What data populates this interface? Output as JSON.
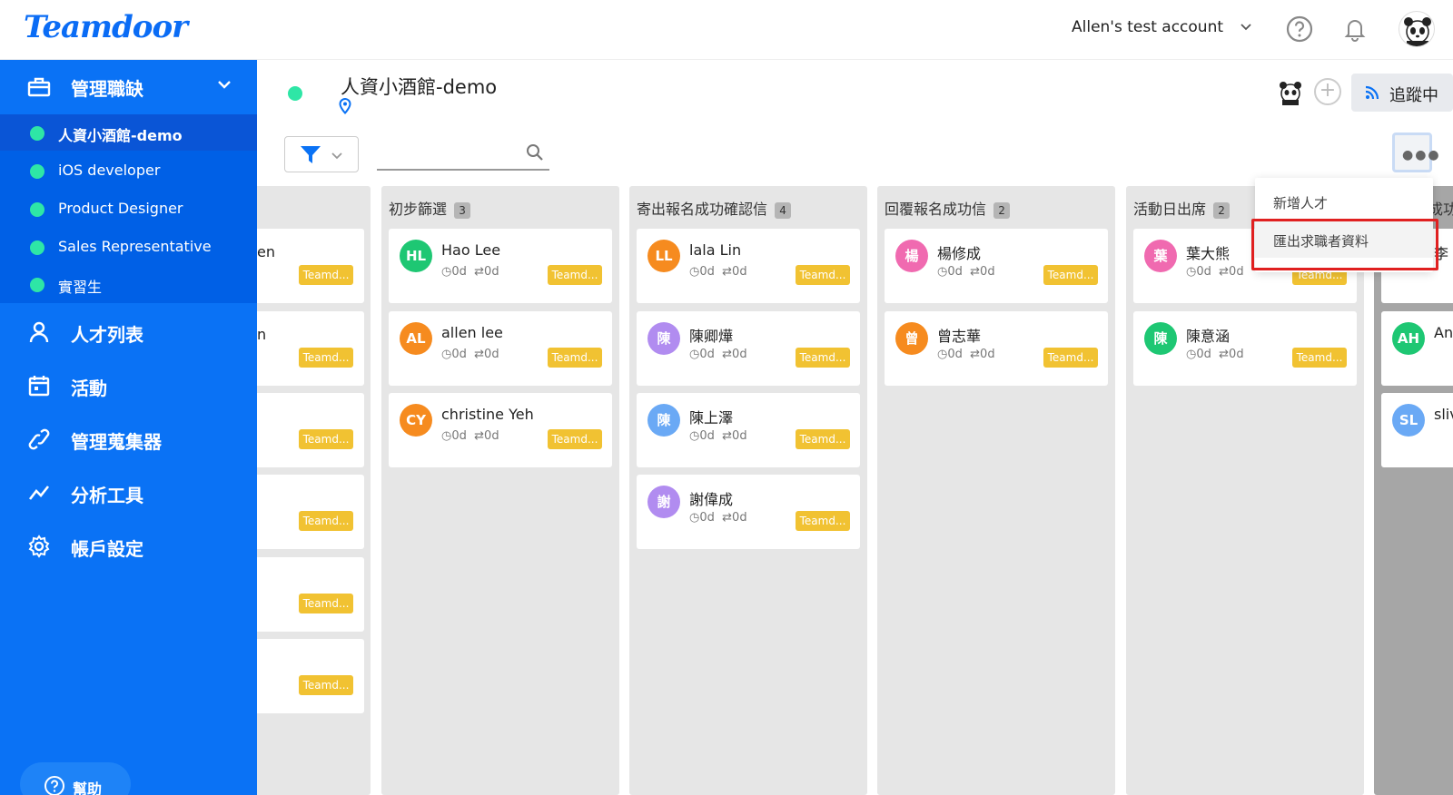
{
  "app": {
    "brand": "Teamdoor"
  },
  "topbar": {
    "account": "Allen's test account",
    "account_chevron": "chevron-down-icon",
    "help_icon": "help-circle-icon",
    "bell_icon": "bell-icon",
    "avatar_icon": "panda-avatar"
  },
  "sidebar": {
    "group": {
      "label": "管理職缺",
      "icon": "briefcase-icon"
    },
    "jobs": [
      {
        "label": "人資小酒館-demo",
        "active": true
      },
      {
        "label": "iOS developer",
        "active": false
      },
      {
        "label": "Product Designer",
        "active": false
      },
      {
        "label": "Sales Representative",
        "active": false
      },
      {
        "label": "實習生",
        "active": false
      }
    ],
    "nav": [
      {
        "label": "人才列表",
        "icon": "person-icon"
      },
      {
        "label": "活動",
        "icon": "calendar-icon"
      },
      {
        "label": "管理蒐集器",
        "icon": "link-icon"
      },
      {
        "label": "分析工具",
        "icon": "chart-line-icon"
      },
      {
        "label": "帳戶設定",
        "icon": "gear-icon"
      }
    ],
    "help_label": "幫助"
  },
  "header": {
    "job_title": "人資小酒館-demo",
    "follow_label": "追蹤中"
  },
  "toolbar": {
    "search_placeholder": ""
  },
  "columns": [
    {
      "title": "初步篩選",
      "count": "3",
      "cards": [
        {
          "initials": "HL",
          "name": "Hao Lee",
          "time": "0d",
          "moves": "0d",
          "tag": "Teamd...",
          "color": "#1ec773"
        },
        {
          "initials": "AL",
          "name": "allen lee",
          "time": "0d",
          "moves": "0d",
          "tag": "Teamd...",
          "color": "#f68b1f"
        },
        {
          "initials": "CY",
          "name": "christine Yeh",
          "time": "0d",
          "moves": "0d",
          "tag": "Teamd...",
          "color": "#f68b1f"
        }
      ]
    },
    {
      "title": "寄出報名成功確認信",
      "count": "4",
      "cards": [
        {
          "initials": "LL",
          "name": "lala Lin",
          "time": "0d",
          "moves": "0d",
          "tag": "Teamd...",
          "color": "#f68b1f"
        },
        {
          "initials": "陳",
          "name": "陳卿燁",
          "time": "0d",
          "moves": "0d",
          "tag": "Teamd...",
          "color": "#b18cf0"
        },
        {
          "initials": "陳",
          "name": "陳上澤",
          "time": "0d",
          "moves": "0d",
          "tag": "Teamd...",
          "color": "#6aa9f5"
        },
        {
          "initials": "謝",
          "name": "謝偉成",
          "time": "0d",
          "moves": "0d",
          "tag": "Teamd...",
          "color": "#b18cf0"
        }
      ]
    },
    {
      "title": "回覆報名成功信",
      "count": "2",
      "cards": [
        {
          "initials": "楊",
          "name": "楊修成",
          "time": "0d",
          "moves": "0d",
          "tag": "Teamd...",
          "color": "#f06ab0"
        },
        {
          "initials": "曾",
          "name": "曾志華",
          "time": "0d",
          "moves": "0d",
          "tag": "Teamd...",
          "color": "#f68b1f"
        }
      ]
    },
    {
      "title": "活動日出席",
      "count": "2",
      "cards": [
        {
          "initials": "葉",
          "name": "葉大熊",
          "time": "0d",
          "moves": "0d",
          "tag": "Teamd...",
          "color": "#f06ab0"
        },
        {
          "initials": "陳",
          "name": "陳意涵",
          "time": "0d",
          "moves": "0d",
          "tag": "Teamd...",
          "color": "#1ec773"
        }
      ]
    }
  ],
  "left_partial_column": {
    "cards": [
      {
        "fragment": "en",
        "tag": "Teamd..."
      },
      {
        "fragment": "n",
        "tag": "Teamd..."
      },
      {
        "fragment": "",
        "tag": "Teamd..."
      },
      {
        "fragment": "",
        "tag": "Teamd..."
      },
      {
        "fragment": "",
        "tag": "Teamd..."
      },
      {
        "fragment": "",
        "tag": "Teamd..."
      }
    ]
  },
  "right_partial_column": {
    "title": "成功",
    "cards": [
      {
        "initials": "",
        "fragment": "李",
        "color": "#1ec773"
      },
      {
        "initials": "AH",
        "fragment": "An",
        "color": "#1ec773"
      },
      {
        "initials": "SL",
        "fragment": "sliv",
        "color": "#6aa9f5"
      }
    ]
  },
  "dropdown": {
    "items": [
      {
        "label": "新增人才"
      },
      {
        "label": "匯出求職者資料"
      }
    ]
  }
}
